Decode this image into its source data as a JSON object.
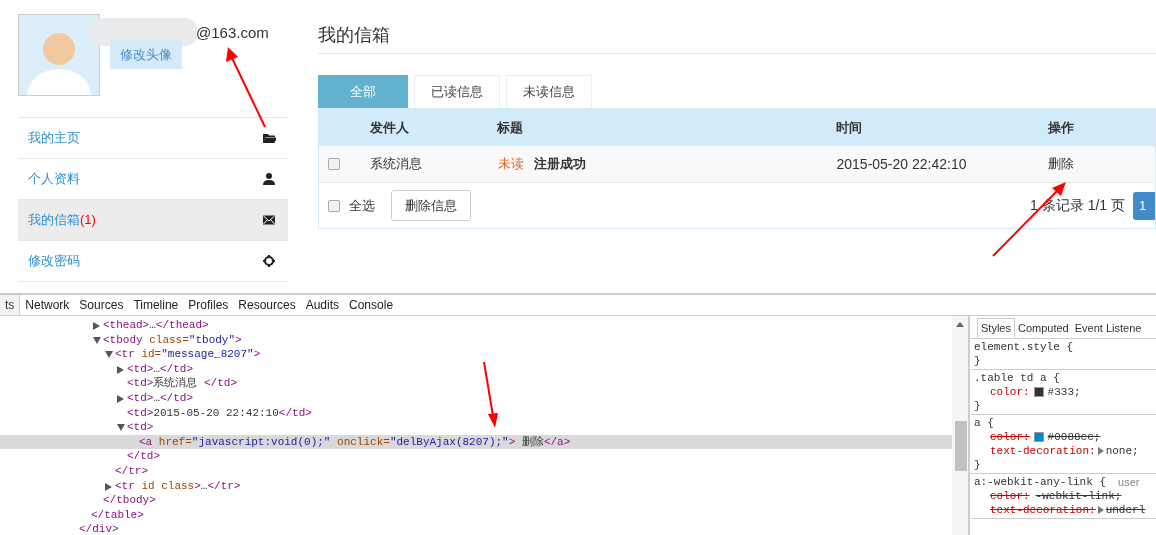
{
  "profile": {
    "email": "@163.com",
    "change_avatar_button": "修改头像"
  },
  "sidebar": {
    "items": [
      {
        "label": "我的主页",
        "selected": false
      },
      {
        "label": "个人资料",
        "selected": false
      },
      {
        "label": "我的信箱",
        "badge": "(1)",
        "selected": true
      },
      {
        "label": "修改密码",
        "selected": false
      }
    ]
  },
  "inbox": {
    "title": "我的信箱",
    "tabs": [
      {
        "label": "全部",
        "selected": true
      },
      {
        "label": "已读信息",
        "selected": false
      },
      {
        "label": "未读信息",
        "selected": false
      }
    ],
    "columns": [
      "发件人",
      "标题",
      "时间",
      "操作"
    ],
    "rows": [
      {
        "checked": false,
        "sender": "系统消息",
        "status": "未读",
        "subject": "注册成功",
        "time": "2015-05-20 22:42:10",
        "action": "删除"
      }
    ],
    "select_all": {
      "label": "全选",
      "checked": false
    },
    "delete_button": "删除信息",
    "pagination": "1 条记录 1/1 页",
    "page_button": "1"
  },
  "devtools": {
    "tabs": [
      {
        "label": "ts",
        "selected": true
      },
      {
        "label": "Network",
        "selected": false
      },
      {
        "label": "Sources",
        "selected": false
      },
      {
        "label": "Timeline",
        "selected": false
      },
      {
        "label": "Profiles",
        "selected": false
      },
      {
        "label": "Resources",
        "selected": false
      },
      {
        "label": "Audits",
        "selected": false
      },
      {
        "label": "Console",
        "selected": false
      }
    ],
    "dom": [
      {
        "close": "</div>",
        "children": [
          {
            "close": "</table>",
            "children": [
              {
                "text": "<thead>…</thead>",
                "expanded": false,
                "selected": false
              },
              {
                "text": "<tbody class=\"tbody\">",
                "expanded": true,
                "selected": false,
                "close": "</tbody>",
                "children": [
                  {
                    "text": "<tr id=\"message_8207\">",
                    "expanded": true,
                    "selected": false,
                    "close": "</tr>",
                    "children": [
                      {
                        "text": "<td>…</td>",
                        "expanded": false,
                        "selected": false
                      },
                      {
                        "text": "<td>系统消息 </td>",
                        "selected": false
                      },
                      {
                        "text": "<td>…</td>",
                        "expanded": false,
                        "selected": false
                      },
                      {
                        "text": "<td>2015-05-20 22:42:10</td>",
                        "selected": false
                      },
                      {
                        "text": "<td>",
                        "expanded": true,
                        "selected": false,
                        "close": "</td>",
                        "children": [
                          {
                            "text": "<a href=\"javascript:void(0);\" onclick=\"delByAjax(8207);\"> 删除</a>",
                            "selected": true
                          }
                        ]
                      }
                    ]
                  },
                  {
                    "text": "<tr id class>…</tr>",
                    "expanded": false,
                    "selected": false
                  }
                ]
              }
            ]
          }
        ]
      }
    ],
    "style_tabs": [
      {
        "label": "Styles",
        "selected": true
      },
      {
        "label": "Computed",
        "selected": false
      },
      {
        "label": "Event Listene",
        "selected": false
      }
    ],
    "rules": [
      {
        "selector": "element.style {",
        "close": "}"
      },
      {
        "selector": ".table td a {",
        "close": "}",
        "props": [
          {
            "name": "color:",
            "value": "#333;",
            "color": "#333333",
            "struck": false,
            "expandable": false
          }
        ]
      },
      {
        "selector": "a {",
        "close": "}",
        "props": [
          {
            "name": "color:",
            "value": "#0088cc;",
            "color": "#0088cc",
            "struck": true,
            "expandable": false
          },
          {
            "name": "text-decoration:",
            "value": "none;",
            "struck": false,
            "expandable": true
          }
        ]
      },
      {
        "selector": "a:-webkit-any-link {",
        "source": "user",
        "props": [
          {
            "name": "color:",
            "value": "-webkit-link;",
            "struck": true,
            "expandable": false
          },
          {
            "name": "text-decoration:",
            "value": "underl",
            "struck": true,
            "expandable": true
          }
        ]
      }
    ]
  }
}
